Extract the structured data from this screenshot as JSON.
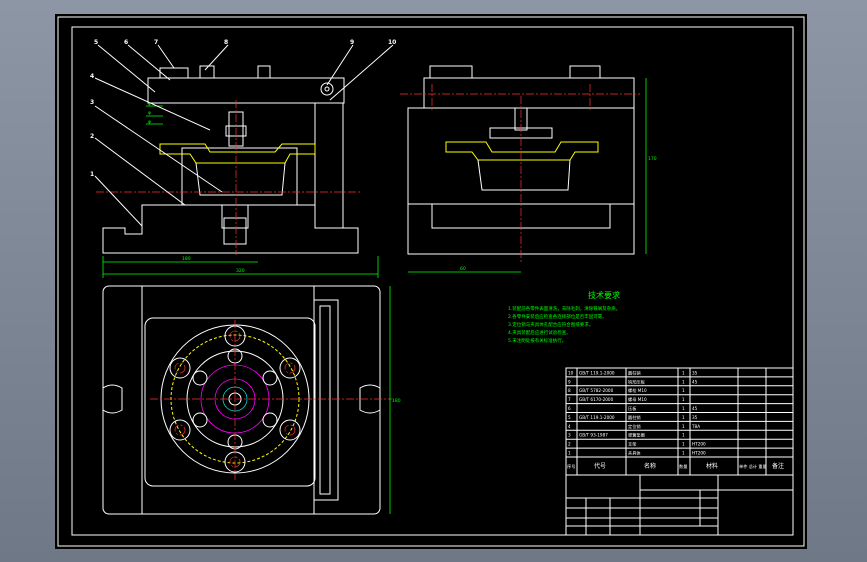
{
  "drawing": {
    "part_labels": [
      "1",
      "2",
      "3",
      "4",
      "5",
      "6",
      "7",
      "8",
      "9",
      "10"
    ],
    "dimensions": {
      "front_width_a": "180",
      "front_width_b": "320",
      "side_width": "60",
      "side_height": "170",
      "top_height": "180"
    }
  },
  "tech_requirements": {
    "title": "技术要求",
    "lines": [
      "1.装配前各零件表面清洗，去除毛刺，清除铁屑及杂质。",
      "2.各零件安装后应检查各连接部位是否牢固可靠。",
      "3.定位销与夹具体孔配合应符合图纸要求。",
      "4.夹具装配后应进行试验检查。",
      "5.未注明处按有关标准执行。"
    ]
  },
  "title_block": {
    "header": {
      "seq": "序号",
      "code": "代号",
      "name": "名称",
      "qty": "数量",
      "material": "材料",
      "weight": "单件 总计 重量",
      "remark": "备注"
    },
    "rows": [
      {
        "seq": "10",
        "code": "GB/T 119.1-2000",
        "name": "圆柱销",
        "qty": "1",
        "material": "35",
        "remark": ""
      },
      {
        "seq": "9",
        "code": "",
        "name": "钩形压板",
        "qty": "1",
        "material": "45",
        "remark": ""
      },
      {
        "seq": "8",
        "code": "GB/T 5782-2000",
        "name": "螺栓 M10",
        "qty": "1",
        "material": "",
        "remark": ""
      },
      {
        "seq": "7",
        "code": "GB/T 6170-2000",
        "name": "螺母 M10",
        "qty": "1",
        "material": "",
        "remark": ""
      },
      {
        "seq": "6",
        "code": "",
        "name": "压板",
        "qty": "1",
        "material": "45",
        "remark": ""
      },
      {
        "seq": "5",
        "code": "GB/T 119.1-2000",
        "name": "圆柱销",
        "qty": "1",
        "material": "35",
        "remark": ""
      },
      {
        "seq": "4",
        "code": "",
        "name": "定位销",
        "qty": "1",
        "material": "T8A",
        "remark": ""
      },
      {
        "seq": "3",
        "code": "GB/T 93-1987",
        "name": "弹簧垫圈",
        "qty": "1",
        "material": "",
        "remark": ""
      },
      {
        "seq": "2",
        "code": "",
        "name": "支架",
        "qty": "1",
        "material": "HT200",
        "remark": ""
      },
      {
        "seq": "1",
        "code": "",
        "name": "夹具体",
        "qty": "1",
        "material": "HT200",
        "remark": ""
      }
    ]
  }
}
